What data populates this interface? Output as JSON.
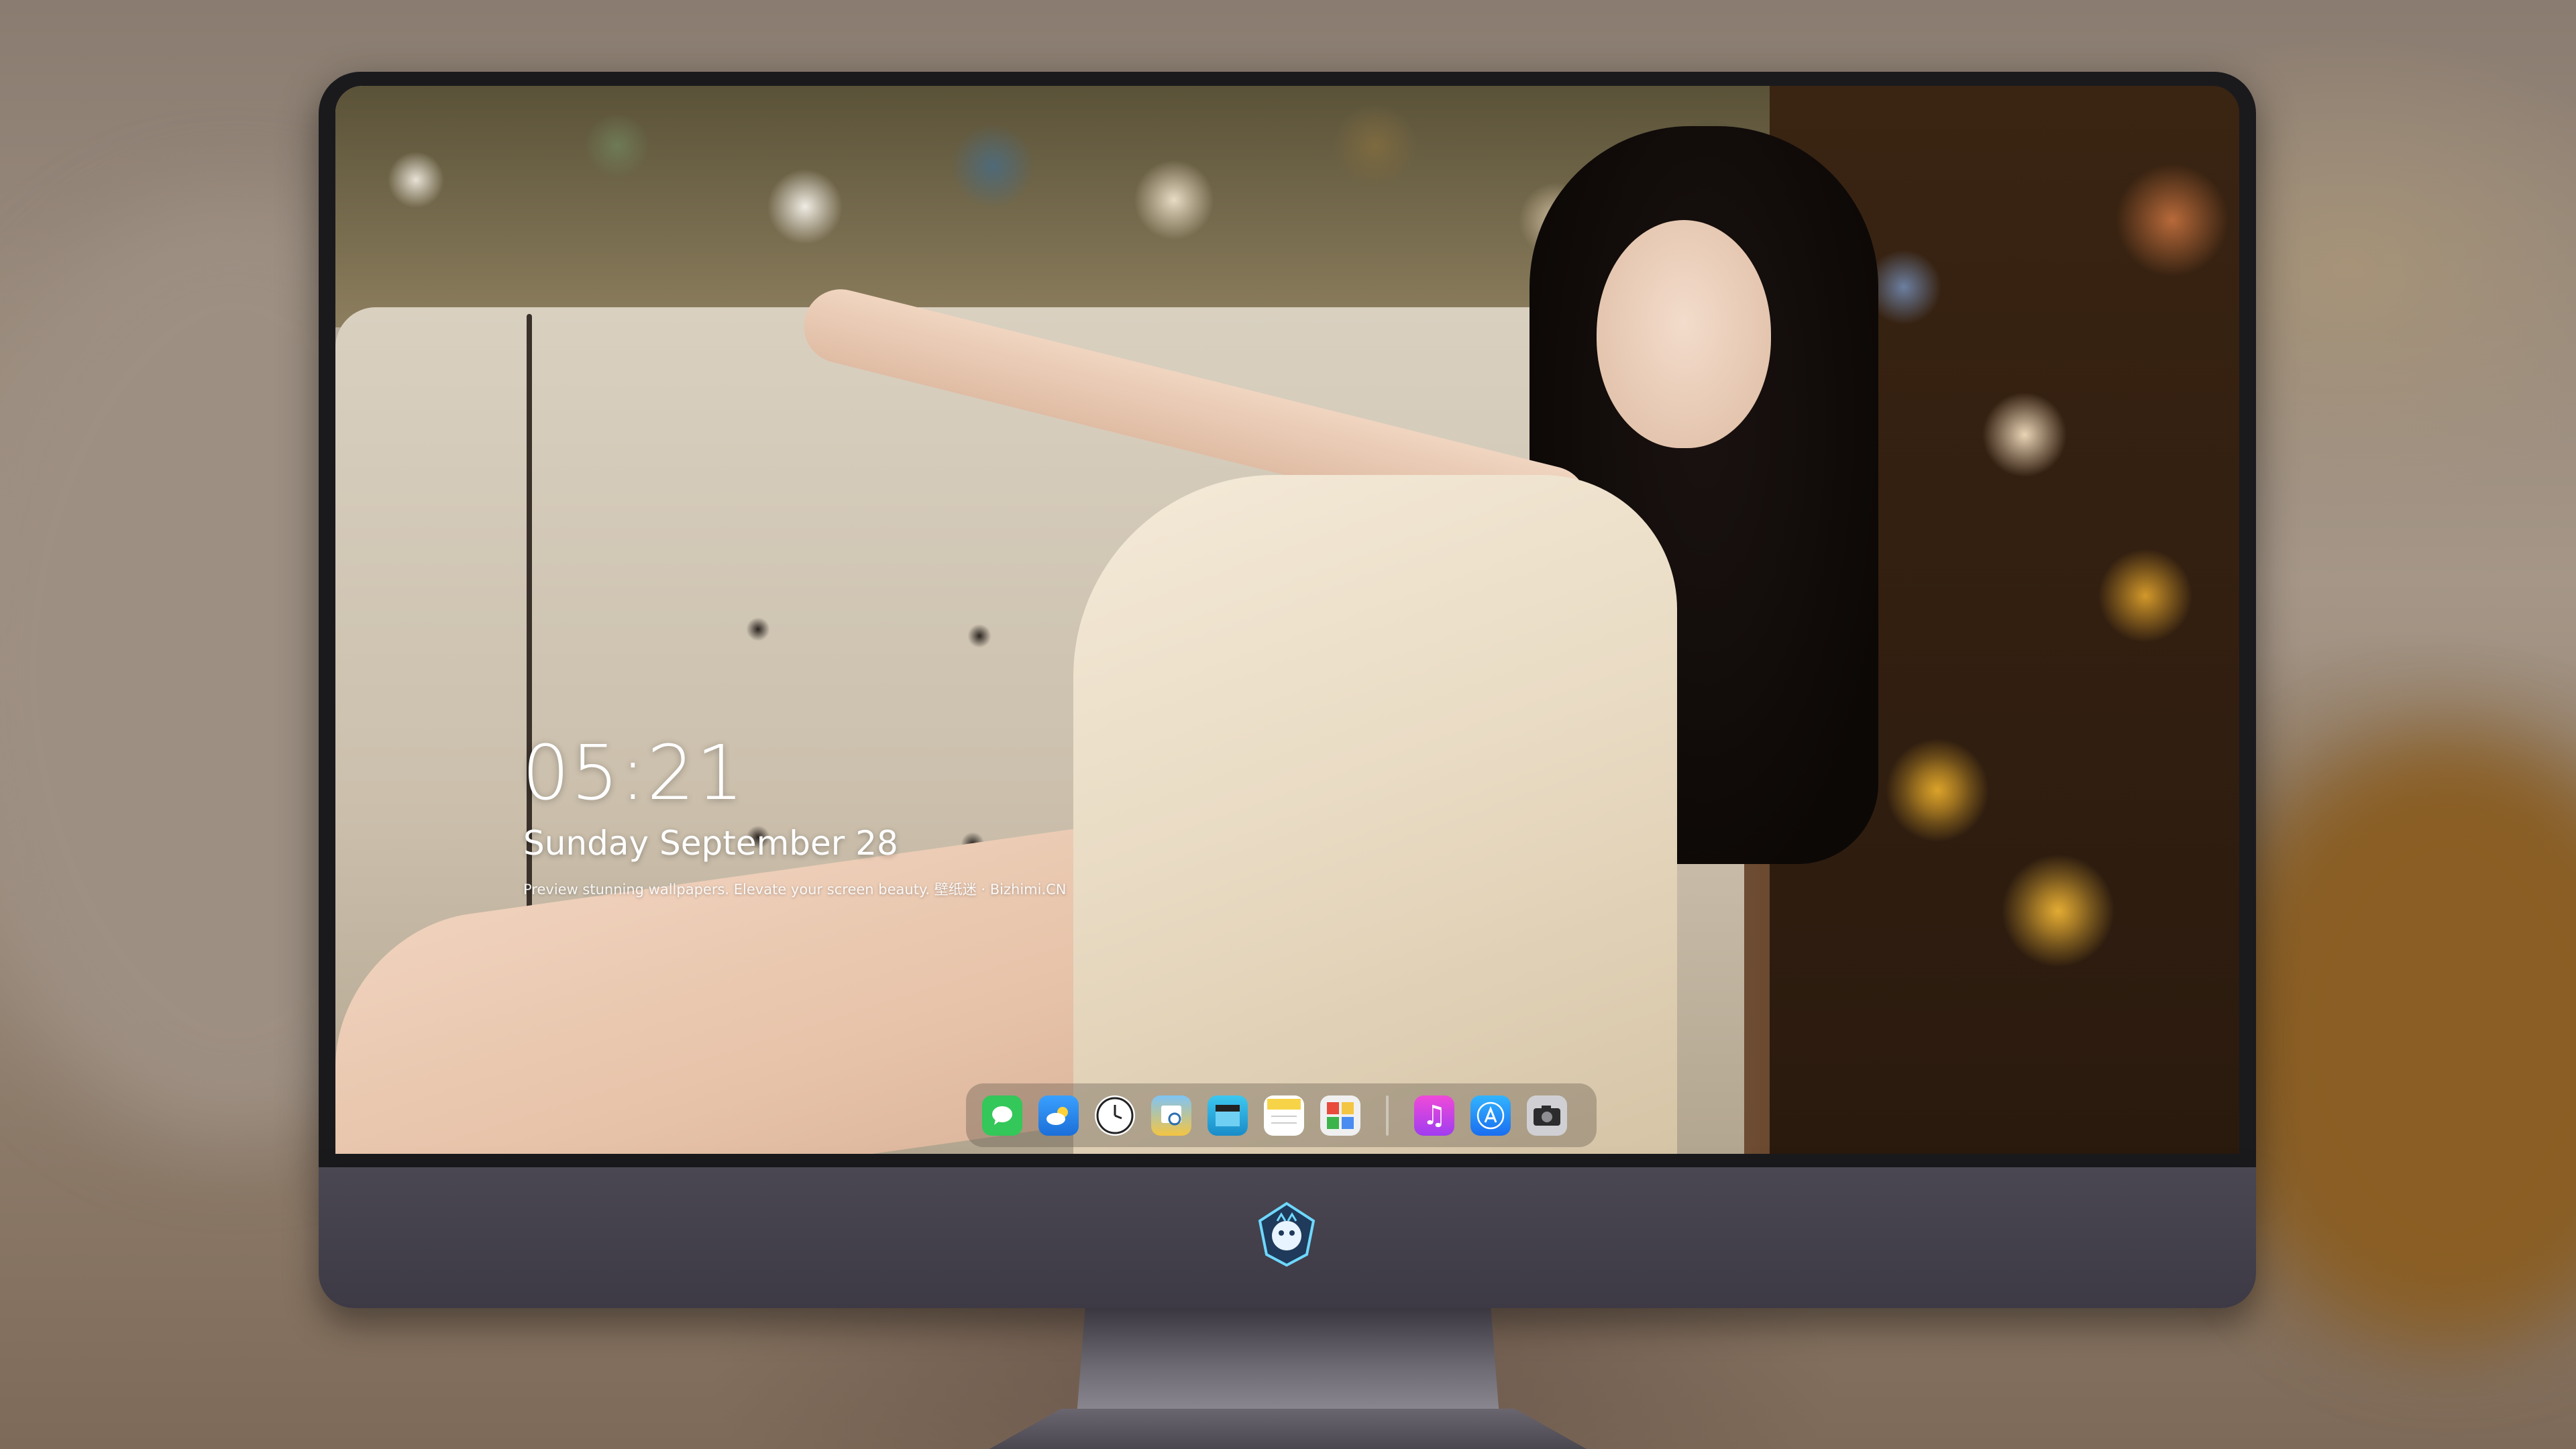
{
  "lockscreen": {
    "time": "05:21",
    "date": "Sunday September  28",
    "tagline": "Preview stunning wallpapers. Elevate your screen beauty. 壁纸迷 · Bizhimi.CN"
  },
  "dock": {
    "apps": [
      {
        "name": "messages-icon",
        "color": "#34c759"
      },
      {
        "name": "weather-icon",
        "color": "#2d8cf0"
      },
      {
        "name": "clock-icon",
        "color": "#1c1c1e"
      },
      {
        "name": "preview-icon",
        "color": "#f4c542"
      },
      {
        "name": "video-editor-icon",
        "color": "#2bb6e8"
      },
      {
        "name": "notes-icon",
        "color": "#f7d447"
      },
      {
        "name": "photo-gallery-icon",
        "color": "#6ab0e8"
      },
      {
        "name": "music-icon",
        "color": "#d83cd8"
      },
      {
        "name": "app-store-icon",
        "color": "#1a8cf0"
      },
      {
        "name": "camera-icon",
        "color": "#8e8e93"
      }
    ]
  },
  "monitor": {
    "logo": "shield-mascot-icon"
  }
}
